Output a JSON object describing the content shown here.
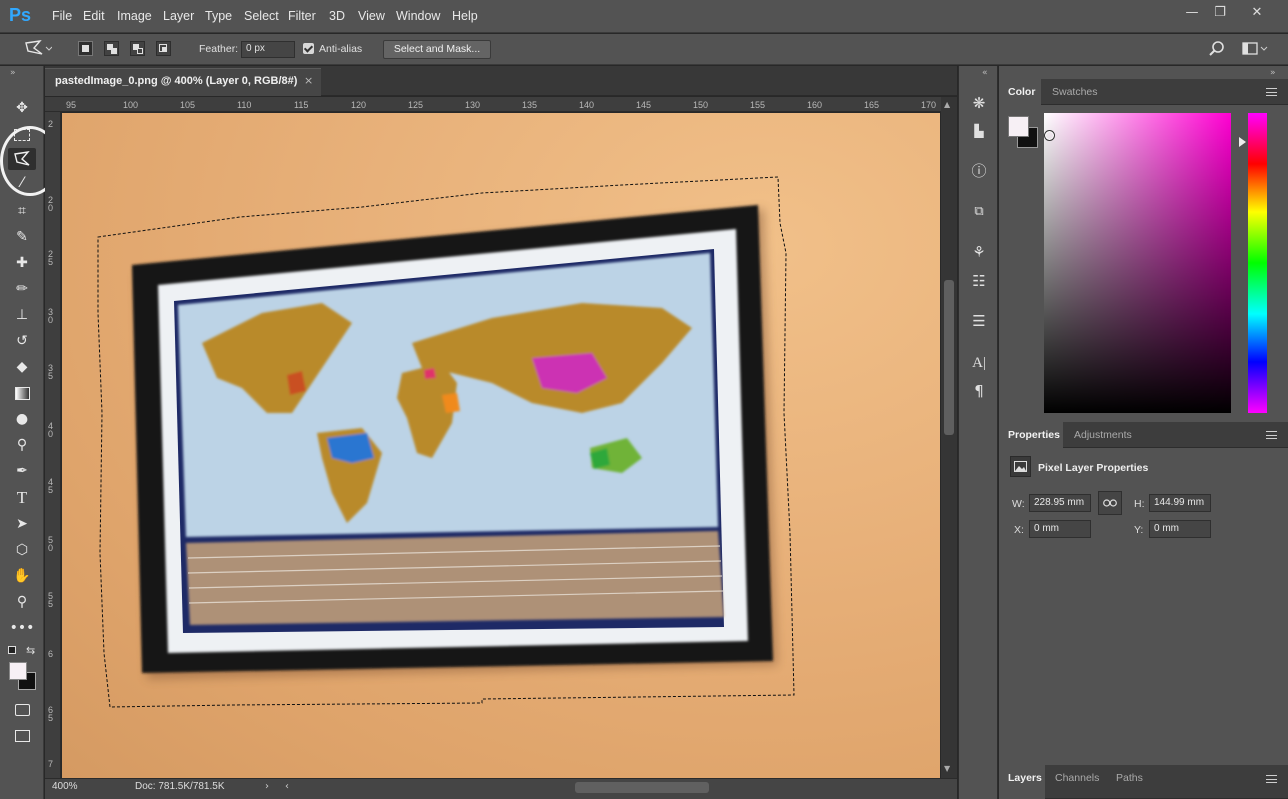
{
  "app": {
    "logo": "Ps"
  },
  "menu": [
    "File",
    "Edit",
    "Image",
    "Layer",
    "Type",
    "Select",
    "Filter",
    "3D",
    "View",
    "Window",
    "Help"
  ],
  "window_controls": [
    "minimize",
    "restore",
    "close"
  ],
  "options_bar": {
    "feather_label": "Feather:",
    "feather_value": "0 px",
    "antialias_label": "Anti-alias",
    "antialias_checked": true,
    "select_mask_label": "Select and Mask..."
  },
  "document": {
    "tab_title": "pastedImage_0.png @ 400% (Layer 0, RGB/8#)",
    "close_glyph": "×",
    "ruler_top_ticks": [
      "95",
      "100",
      "105",
      "110",
      "115",
      "120",
      "125",
      "130",
      "135",
      "140",
      "145",
      "150",
      "155",
      "160",
      "165",
      "170"
    ],
    "ruler_left_ticks": [
      "2",
      "2 0",
      "2 5",
      "3 0",
      "3 5",
      "4 0",
      "4 5",
      "5 0",
      "5 5",
      "6",
      "6 5",
      "7"
    ],
    "zoom": "400%",
    "doc_size": "Doc: 781.5K/781.5K"
  },
  "tools": [
    "move-tool",
    "marquee-tool",
    "polygonal-lasso-tool",
    "magic-wand-tool",
    "crop-tool",
    "eyedropper-tool",
    "healing-brush-tool",
    "brush-tool",
    "clone-stamp-tool",
    "history-brush-tool",
    "eraser-tool",
    "gradient-tool",
    "blur-tool",
    "dodge-tool",
    "pen-tool",
    "type-tool",
    "path-selection-tool",
    "shape-tool",
    "hand-tool",
    "zoom-tool",
    "more-tools",
    "quick-mask",
    "screen-mode"
  ],
  "color_panel": {
    "tabs": [
      "Color",
      "Swatches"
    ],
    "active_tab": "Color",
    "foreground": "#f7f0f5",
    "background": "#111111",
    "hue_color": "#ff00d2"
  },
  "properties_panel": {
    "tabs": [
      "Properties",
      "Adjustments"
    ],
    "active_tab": "Properties",
    "title": "Pixel Layer Properties",
    "w_label": "W:",
    "w_value": "228.95 mm",
    "h_label": "H:",
    "h_value": "144.99 mm",
    "x_label": "X:",
    "x_value": "0 mm",
    "y_label": "Y:",
    "y_value": "0 mm"
  },
  "layers_panel": {
    "tabs": [
      "Layers",
      "Channels",
      "Paths"
    ],
    "active_tab": "Layers"
  }
}
